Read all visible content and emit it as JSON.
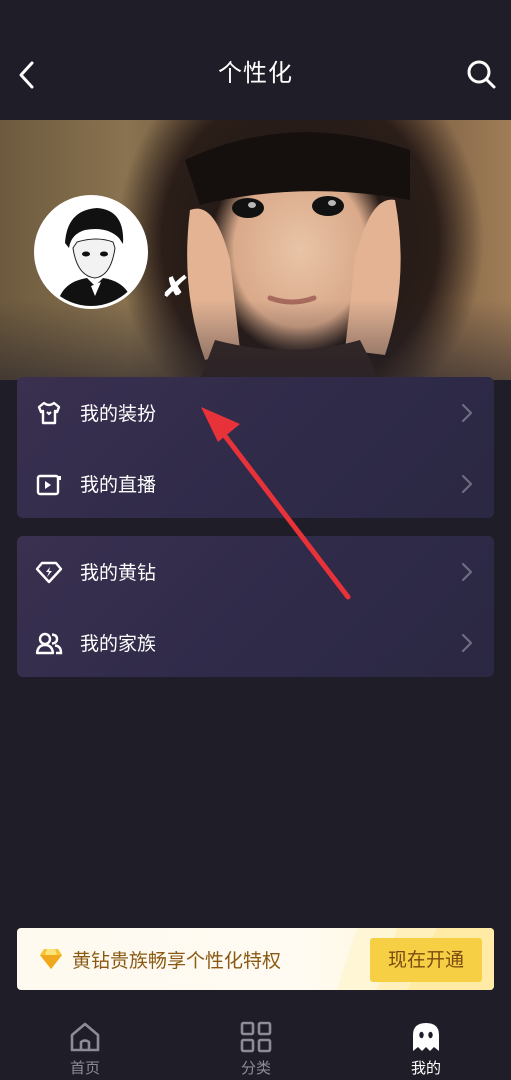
{
  "header": {
    "title": "个性化"
  },
  "profile": {
    "badge": "✘"
  },
  "menu_groups": [
    [
      {
        "label": "我的装扮",
        "icon": "shirt-icon"
      },
      {
        "label": "我的直播",
        "icon": "live-video-icon"
      }
    ],
    [
      {
        "label": "我的黄钻",
        "icon": "diamond-icon"
      },
      {
        "label": "我的家族",
        "icon": "group-icon"
      }
    ]
  ],
  "promo": {
    "text": "黄钻贵族畅享个性化特权",
    "button": "现在开通",
    "icon": "yellow-diamond-icon"
  },
  "tabs": [
    {
      "label": "首页",
      "icon": "home-icon",
      "active": false
    },
    {
      "label": "分类",
      "icon": "grid-icon",
      "active": false
    },
    {
      "label": "我的",
      "icon": "ghost-icon",
      "active": true
    }
  ],
  "colors": {
    "background": "#1f1d27",
    "card": "#2e2a48",
    "promo_button": "#f6cf45",
    "annotation_arrow": "#e8323a"
  }
}
